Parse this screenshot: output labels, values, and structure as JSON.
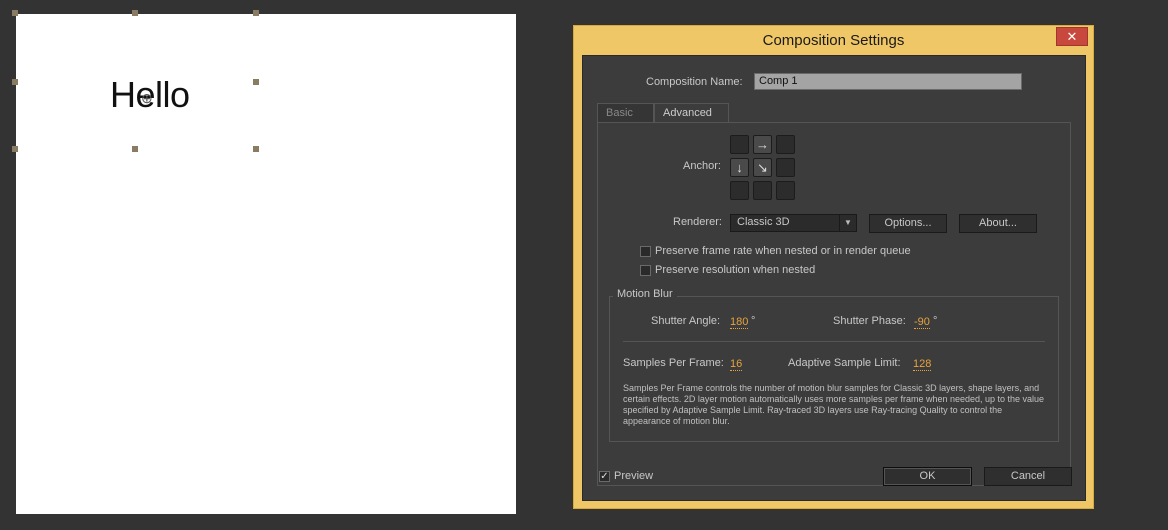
{
  "canvas": {
    "text": "Hello"
  },
  "dialog": {
    "title": "Composition Settings",
    "close_icon": "close-icon",
    "comp_name_label": "Composition Name:",
    "comp_name_value": "Comp 1",
    "tabs": [
      {
        "label": "Basic",
        "active": false
      },
      {
        "label": "Advanced",
        "active": true
      }
    ],
    "anchor_label": "Anchor:",
    "anchor_icons": {
      "top_center": "arrow-right-icon",
      "middle_left": "arrow-down-icon",
      "center": "arrow-down-right-icon"
    },
    "renderer_label": "Renderer:",
    "renderer_value": "Classic 3D",
    "options_button": "Options...",
    "about_button": "About...",
    "preserve_frame_rate": {
      "label": "Preserve frame rate when nested or in render queue",
      "checked": false
    },
    "preserve_resolution": {
      "label": "Preserve resolution when nested",
      "checked": false
    },
    "motion_blur": {
      "legend": "Motion Blur",
      "shutter_angle_label": "Shutter Angle:",
      "shutter_angle_value": "180",
      "shutter_angle_unit": "°",
      "shutter_phase_label": "Shutter Phase:",
      "shutter_phase_value": "-90",
      "shutter_phase_unit": "°",
      "samples_per_frame_label": "Samples Per Frame:",
      "samples_per_frame_value": "16",
      "adaptive_limit_label": "Adaptive Sample Limit:",
      "adaptive_limit_value": "128",
      "description": "Samples Per Frame controls the number of motion blur samples for Classic 3D layers, shape layers, and certain effects. 2D layer motion automatically uses more samples per frame when needed, up to the value specified by Adaptive Sample Limit. Ray-traced 3D layers use Ray-tracing Quality to control the appearance of motion blur."
    },
    "preview": {
      "label": "Preview",
      "checked": true
    },
    "ok_button": "OK",
    "cancel_button": "Cancel"
  },
  "colors": {
    "title_bar": "#f0c766",
    "accent_value": "#e8a33c",
    "panel_bg": "#3c3c3c",
    "close_button": "#c9483d"
  }
}
